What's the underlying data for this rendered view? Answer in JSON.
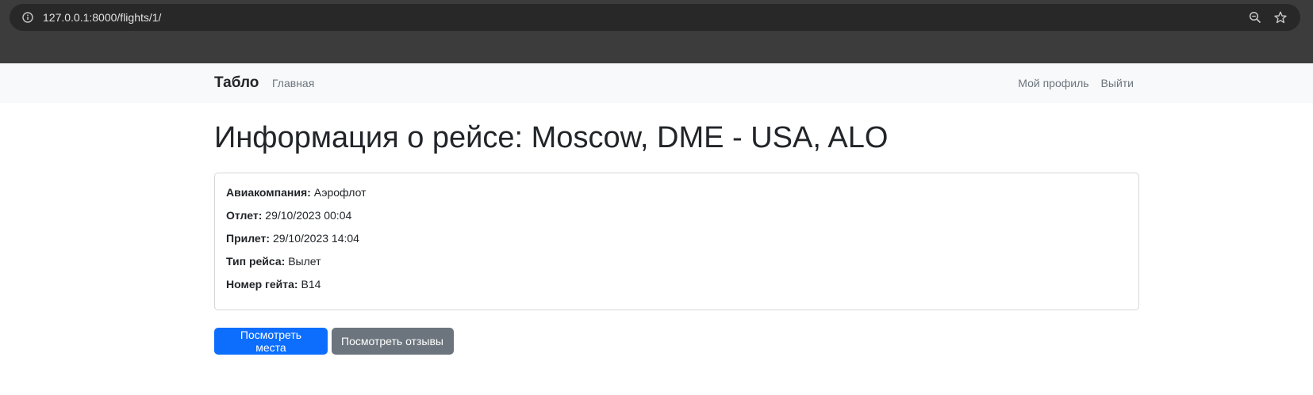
{
  "browser": {
    "url": "127.0.0.1:8000/flights/1/",
    "icons": [
      "info-icon",
      "zoom-icon",
      "star-icon"
    ]
  },
  "navbar": {
    "brand": "Табло",
    "home": "Главная",
    "profile": "Мой профиль",
    "logout": "Выйти"
  },
  "page": {
    "title": "Информация о рейсе: Moscow, DME - USA, ALO"
  },
  "flight": {
    "airline_label": "Авиакомпания:",
    "airline_value": "Аэрофлот",
    "departure_label": "Отлет:",
    "departure_value": "29/10/2023 00:04",
    "arrival_label": "Прилет:",
    "arrival_value": "29/10/2023 14:04",
    "type_label": "Тип рейса:",
    "type_value": "Вылет",
    "gate_label": "Номер гейта:",
    "gate_value": "B14"
  },
  "actions": {
    "seats": "Посмотреть места",
    "reviews": "Посмотреть отзывы"
  },
  "colors": {
    "primary": "#0d6efd",
    "secondary": "#6c757d",
    "chrome": "#3c3c3c",
    "omnibox": "#282828"
  }
}
